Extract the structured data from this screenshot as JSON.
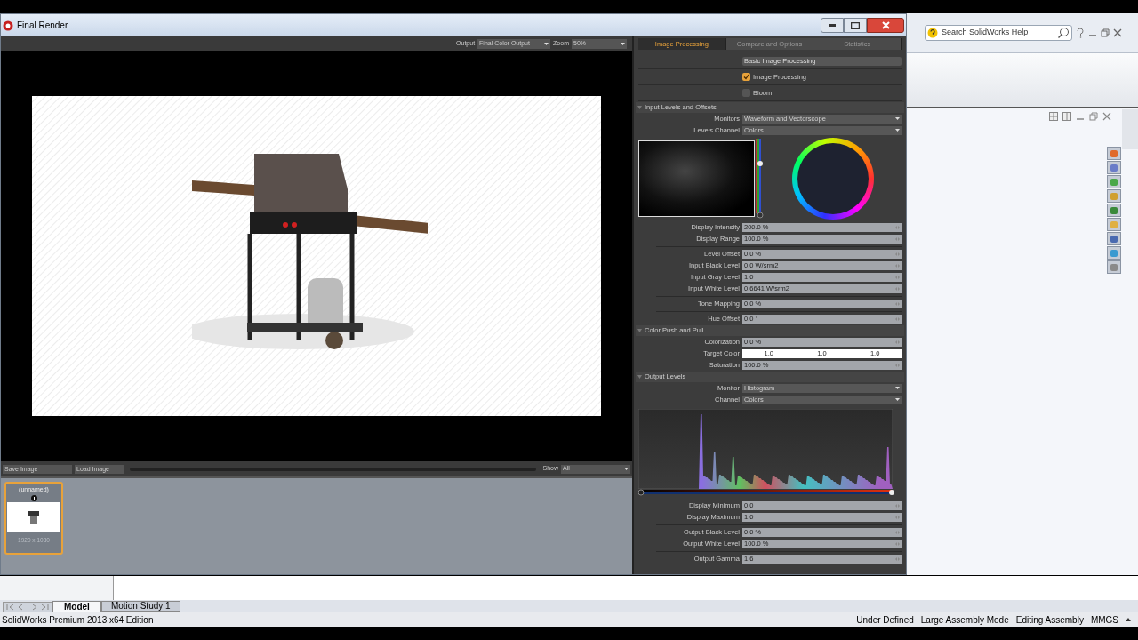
{
  "window": {
    "title": "Final Render"
  },
  "toolbar": {
    "output_label": "Output",
    "output_value": "Final Color Output",
    "zoom_label": "Zoom",
    "zoom_value": "50%"
  },
  "image_bar": {
    "save": "Save Image",
    "load": "Load Image",
    "show_label": "Show",
    "show_value": "All"
  },
  "thumbnails": [
    {
      "title": "(unnamed)",
      "size": "1920 x 1080",
      "selected": true
    }
  ],
  "panel": {
    "tabs": [
      {
        "label": "Image Processing",
        "selected": true
      },
      {
        "label": "Compare and Options",
        "selected": false
      },
      {
        "label": "Statistics",
        "selected": false
      }
    ],
    "preset": "Basic Image Processing",
    "checkboxes": [
      {
        "label": "Image Processing",
        "checked": true
      },
      {
        "label": "Bloom",
        "checked": false
      }
    ],
    "sections": [
      {
        "title": "Input Levels and Offsets",
        "expanded": true,
        "rows": [
          {
            "kind": "select",
            "label": "Monitors",
            "value": "Waveform and Vectorscope"
          },
          {
            "kind": "select",
            "label": "Levels Channel",
            "value": "Colors"
          },
          {
            "kind": "scope"
          },
          {
            "kind": "value",
            "label": "Display Intensity",
            "value": "200.0 %"
          },
          {
            "kind": "value",
            "label": "Display Range",
            "value": "100.0 %"
          },
          {
            "kind": "divider"
          },
          {
            "kind": "value",
            "label": "Level Offset",
            "value": "0.0 %"
          },
          {
            "kind": "value",
            "label": "Input Black Level",
            "value": "0.0 W/srm2"
          },
          {
            "kind": "value",
            "label": "Input Gray Level",
            "value": "1.0"
          },
          {
            "kind": "value",
            "label": "Input White Level",
            "value": "0.6641 W/srm2"
          },
          {
            "kind": "divider"
          },
          {
            "kind": "value",
            "label": "Tone Mapping",
            "value": "0.0 %"
          },
          {
            "kind": "divider"
          },
          {
            "kind": "value",
            "label": "Hue Offset",
            "value": "0.0 °"
          }
        ]
      },
      {
        "title": "Color Push and Pull",
        "expanded": true,
        "rows": [
          {
            "kind": "value",
            "label": "Colorization",
            "value": "0.0 %"
          },
          {
            "kind": "triple",
            "label": "Target Color",
            "values": [
              "1.0",
              "1.0",
              "1.0"
            ]
          },
          {
            "kind": "value",
            "label": "Saturation",
            "value": "100.0 %"
          }
        ]
      },
      {
        "title": "Output Levels",
        "expanded": true,
        "rows": [
          {
            "kind": "select",
            "label": "Monitor",
            "value": "Histogram"
          },
          {
            "kind": "select",
            "label": "Channel",
            "value": "Colors"
          },
          {
            "kind": "histogram"
          },
          {
            "kind": "value",
            "label": "Display Minimum",
            "value": "0.0"
          },
          {
            "kind": "value",
            "label": "Display Maximum",
            "value": "1.0"
          },
          {
            "kind": "divider"
          },
          {
            "kind": "value",
            "label": "Output Black Level",
            "value": "0.0 %"
          },
          {
            "kind": "value",
            "label": "Output White Level",
            "value": "100.0 %"
          },
          {
            "kind": "divider"
          },
          {
            "kind": "value",
            "label": "Output Gamma",
            "value": "1.6"
          }
        ]
      }
    ]
  },
  "help_search": {
    "placeholder": "Search SolidWorks Help"
  },
  "bottom_tabs": [
    {
      "label": "Model",
      "selected": true
    },
    {
      "label": "Motion Study 1",
      "selected": false
    }
  ],
  "status_bar": {
    "edition": "SolidWorks Premium 2013 x64 Edition",
    "items": [
      "Under Defined",
      "Large Assembly Mode",
      "Editing Assembly",
      "MMGS"
    ]
  }
}
